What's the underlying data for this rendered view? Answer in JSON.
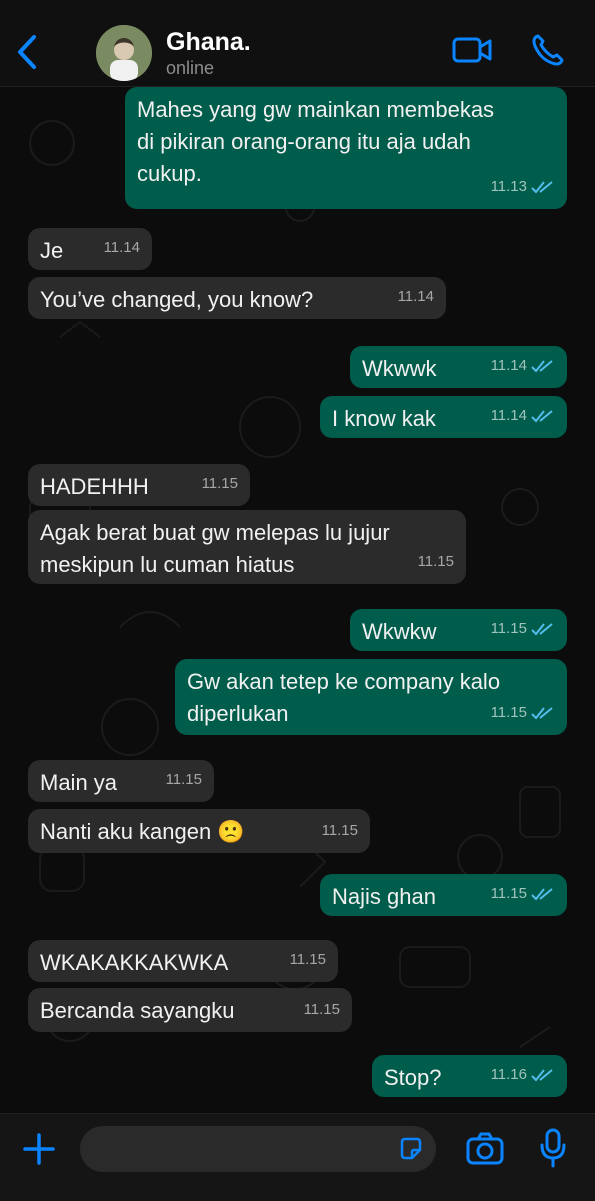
{
  "header": {
    "title": "Ghana.",
    "status": "online"
  },
  "messages": [
    {
      "dir": "out",
      "text": "Mahes yang gw mainkan membekas\ndi pikiran orang-orang itu aja udah\ncukup.",
      "time": "11.13"
    },
    {
      "dir": "in",
      "text": "Je",
      "time": "11.14"
    },
    {
      "dir": "in",
      "text": "You’ve changed, you know?",
      "time": "11.14"
    },
    {
      "dir": "out",
      "text": "Wkwwk",
      "time": "11.14"
    },
    {
      "dir": "out",
      "text": "I know kak",
      "time": "11.14"
    },
    {
      "dir": "in",
      "text": "HADEHHH",
      "time": "11.15"
    },
    {
      "dir": "in",
      "text": "Agak berat buat gw melepas lu jujur\nmeskipun lu cuman hiatus",
      "time": "11.15"
    },
    {
      "dir": "out",
      "text": "Wkwkw",
      "time": "11.15"
    },
    {
      "dir": "out",
      "text": "Gw akan tetep ke company kalo\ndiperlukan",
      "time": "11.15"
    },
    {
      "dir": "in",
      "text": "Main ya",
      "time": "11.15"
    },
    {
      "dir": "in",
      "text": "Nanti aku kangen 🙁",
      "time": "11.15"
    },
    {
      "dir": "out",
      "text": "Najis ghan",
      "time": "11.15"
    },
    {
      "dir": "in",
      "text": "WKAKAKKAKWKA",
      "time": "11.15"
    },
    {
      "dir": "in",
      "text": "Bercanda sayangku",
      "time": "11.15"
    },
    {
      "dir": "out",
      "text": "Stop?",
      "time": "11.16"
    }
  ],
  "icons": {
    "back": "chevron-left-icon",
    "video": "video-camera-icon",
    "call": "phone-icon",
    "add": "plus-icon",
    "sticker": "sticker-icon",
    "camera": "camera-icon",
    "mic": "microphone-icon",
    "read": "double-check-icon"
  },
  "colors": {
    "accent": "#0a84ff",
    "incoming": "#2b2b2b",
    "outgoing": "#005c4b",
    "read_ticks": "#53bdeb"
  }
}
